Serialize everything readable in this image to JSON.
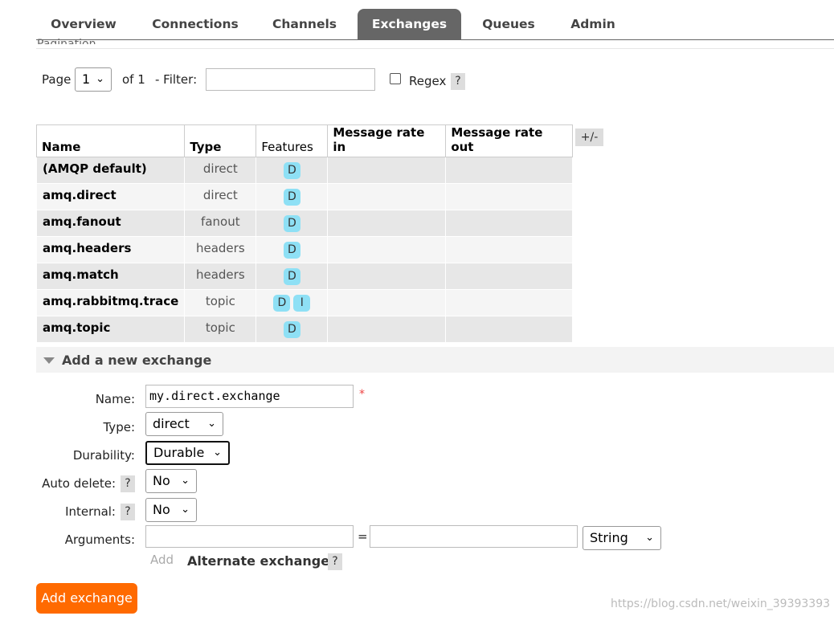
{
  "tabs": [
    {
      "label": "Overview",
      "active": false
    },
    {
      "label": "Connections",
      "active": false
    },
    {
      "label": "Channels",
      "active": false
    },
    {
      "label": "Exchanges",
      "active": true
    },
    {
      "label": "Queues",
      "active": false
    },
    {
      "label": "Admin",
      "active": false
    }
  ],
  "pagination": {
    "section_title": "Pagination",
    "page_label": "Page",
    "page_value": "1",
    "of_label": "of 1",
    "filter_label": "- Filter:",
    "filter_value": "",
    "regex_label": "Regex",
    "help": "?"
  },
  "table": {
    "columns": [
      "Name",
      "Type",
      "Features",
      "Message rate in",
      "Message rate out"
    ],
    "toggle_columns": "+/-",
    "rows": [
      {
        "name": "(AMQP default)",
        "type": "direct",
        "features": [
          "D"
        ],
        "rate_in": "",
        "rate_out": ""
      },
      {
        "name": "amq.direct",
        "type": "direct",
        "features": [
          "D"
        ],
        "rate_in": "",
        "rate_out": ""
      },
      {
        "name": "amq.fanout",
        "type": "fanout",
        "features": [
          "D"
        ],
        "rate_in": "",
        "rate_out": ""
      },
      {
        "name": "amq.headers",
        "type": "headers",
        "features": [
          "D"
        ],
        "rate_in": "",
        "rate_out": ""
      },
      {
        "name": "amq.match",
        "type": "headers",
        "features": [
          "D"
        ],
        "rate_in": "",
        "rate_out": ""
      },
      {
        "name": "amq.rabbitmq.trace",
        "type": "topic",
        "features": [
          "D",
          "I"
        ],
        "rate_in": "",
        "rate_out": ""
      },
      {
        "name": "amq.topic",
        "type": "topic",
        "features": [
          "D"
        ],
        "rate_in": "",
        "rate_out": ""
      }
    ]
  },
  "add_exchange": {
    "section_title": "Add a new exchange",
    "name_label": "Name:",
    "name_value": "my.direct.exchange",
    "required_mark": "*",
    "type_label": "Type:",
    "type_value": "direct",
    "durability_label": "Durability:",
    "durability_value": "Durable",
    "auto_delete_label": "Auto delete:",
    "auto_delete_value": "No",
    "internal_label": "Internal:",
    "internal_value": "No",
    "arguments_label": "Arguments:",
    "arg_key": "",
    "equals": "=",
    "arg_value": "",
    "arg_type": "String",
    "add_link": "Add",
    "alternate_exchange": "Alternate exchange",
    "help": "?",
    "submit_label": "Add exchange"
  },
  "watermark": "https://blog.csdn.net/weixin_39393393",
  "colors": {
    "accent": "#ff6a00",
    "tab_active": "#666666",
    "badge": "#8ee0f5"
  }
}
